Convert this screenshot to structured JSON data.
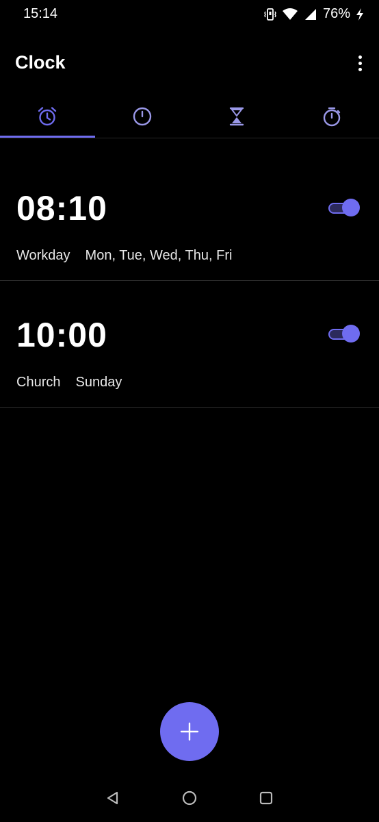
{
  "status_bar": {
    "time": "15:14",
    "battery": "76%",
    "icons": [
      "vibrate-icon",
      "wifi-icon",
      "signal-icon",
      "charging-icon"
    ]
  },
  "app_bar": {
    "title": "Clock",
    "menu_icon": "more-vert-icon"
  },
  "tabs": [
    {
      "name": "alarm",
      "icon": "alarm-icon",
      "active": true
    },
    {
      "name": "clock",
      "icon": "clock-icon",
      "active": false
    },
    {
      "name": "timer",
      "icon": "hourglass-icon",
      "active": false
    },
    {
      "name": "stopwatch",
      "icon": "stopwatch-icon",
      "active": false
    }
  ],
  "alarms": [
    {
      "time": "08:10",
      "label": "Workday",
      "days": "Mon, Tue, Wed, Thu, Fri",
      "enabled": true
    },
    {
      "time": "10:00",
      "label": "Church",
      "days": "Sunday",
      "enabled": true
    }
  ],
  "fab": {
    "icon": "plus-icon"
  },
  "nav_bar": {
    "icons": [
      "back-icon",
      "home-icon",
      "recents-icon"
    ]
  },
  "colors": {
    "accent": "#6f6cf0",
    "background": "#000000",
    "text": "#ffffff",
    "divider": "#262626"
  }
}
